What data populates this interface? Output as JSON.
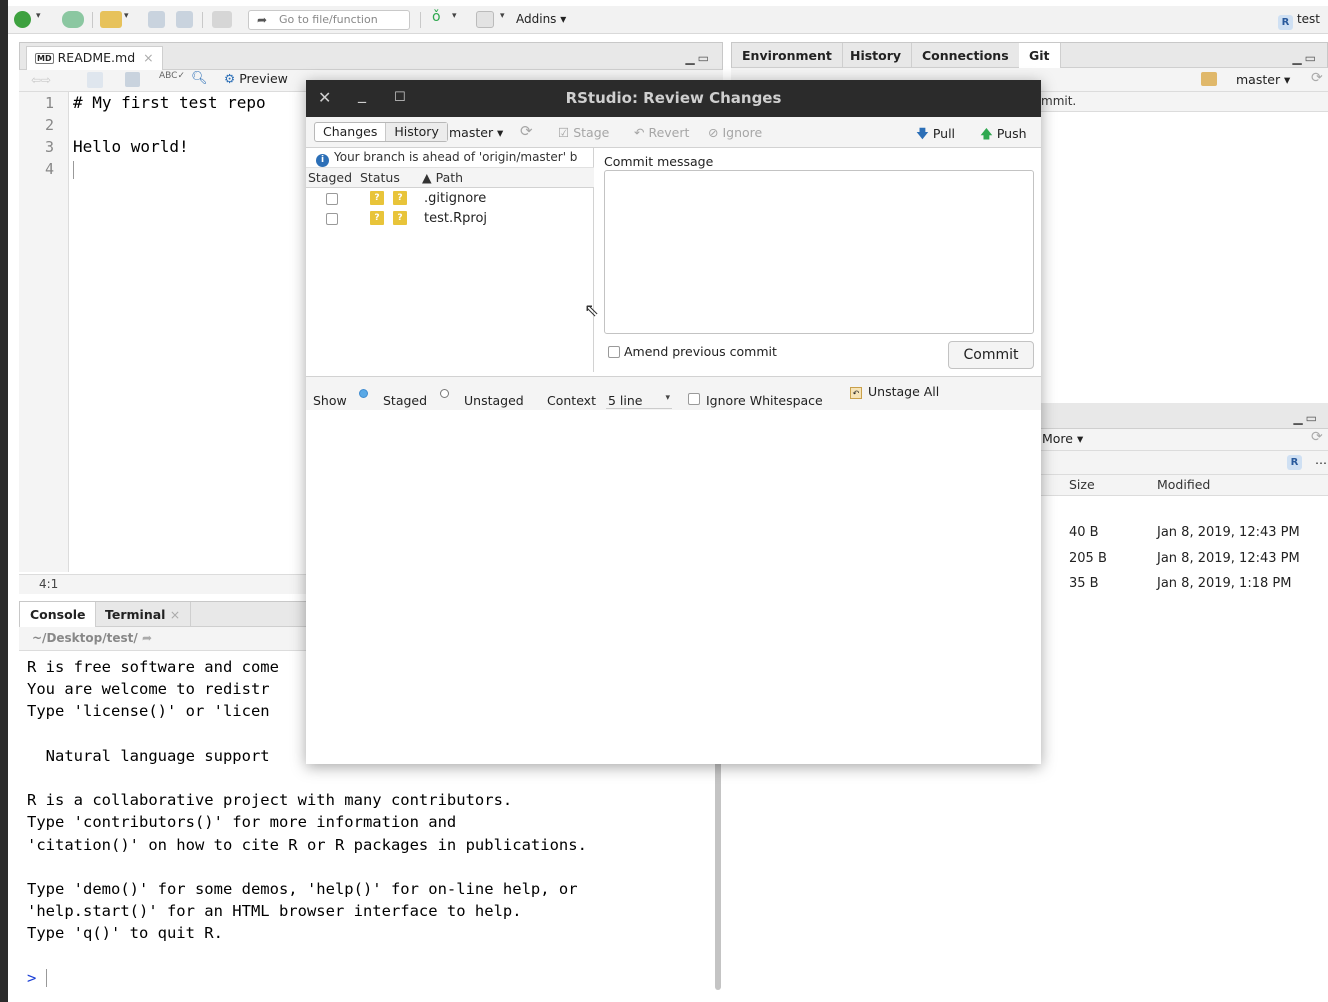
{
  "toolbar": {
    "goto_placeholder": "Go to file/function",
    "addins_label": "Addins ▾",
    "project_label": "test",
    "project_badge": "R"
  },
  "editor": {
    "tab_icon_label": "MD",
    "tab_title": "README.md",
    "tab_close": "×",
    "preview_label": "Preview",
    "line_numbers": [
      "1",
      "2",
      "3",
      "4"
    ],
    "lines": [
      "# My first test repo",
      "",
      "Hello world!",
      ""
    ],
    "cursor_position": "4:1"
  },
  "console": {
    "tabs": [
      "Console",
      "Terminal"
    ],
    "terminal_close": "×",
    "path": "~/Desktop/test/",
    "lines": [
      "R is free software and come",
      "You are welcome to redistr",
      "Type 'license()' or 'licen",
      "",
      "  Natural language support",
      "",
      "R is a collaborative project with many contributors.",
      "Type 'contributors()' for more information and",
      "'citation()' on how to cite R or R packages in publications.",
      "",
      "Type 'demo()' for some demos, 'help()' for on-line help, or",
      "'help.start()' for an HTML browser interface to help.",
      "Type 'q()' to quit R.",
      "",
      ""
    ],
    "prompt": ">"
  },
  "env_pane": {
    "tabs": [
      "Environment",
      "History",
      "Connections",
      "Git"
    ],
    "branch_label": "master ▾",
    "sub_text": "mmit."
  },
  "files_pane": {
    "more_label": "More ▾",
    "columns": [
      "Size",
      "Modified"
    ],
    "rows": [
      {
        "size": "40 B",
        "modified": "Jan 8, 2019, 12:43 PM"
      },
      {
        "size": "205 B",
        "modified": "Jan 8, 2019, 12:43 PM"
      },
      {
        "size": "35 B",
        "modified": "Jan 8, 2019, 1:18 PM"
      }
    ]
  },
  "dialog": {
    "title": "RStudio: Review Changes",
    "close": "✕",
    "minimize": "_",
    "maximize": "☐",
    "view_tabs": [
      "Changes",
      "History"
    ],
    "branch": "master ▾",
    "stage": "Stage",
    "revert": "Revert",
    "ignore": "Ignore",
    "pull": "Pull",
    "push": "Push",
    "info_icon": "i",
    "ahead_message": "Your branch is ahead of 'origin/master' b",
    "columns": {
      "staged": "Staged",
      "status": "Status",
      "path": "▲ Path"
    },
    "files": [
      {
        "status_a": "?",
        "status_b": "?",
        "path": ".gitignore"
      },
      {
        "status_a": "?",
        "status_b": "?",
        "path": "test.Rproj"
      }
    ],
    "commit_message_label": "Commit message",
    "amend_label": "Amend previous commit",
    "commit_button": "Commit",
    "show_label": "Show",
    "staged_label": "Staged",
    "unstaged_label": "Unstaged",
    "context_label": "Context",
    "context_value": "5 line",
    "ignore_whitespace_label": "Ignore Whitespace",
    "unstage_all_label": "Unstage All"
  },
  "colors": {
    "title_bar": "#2b2b2b",
    "accent_blue": "#2c6fb7",
    "status_yellow": "#e8c43a",
    "push_green": "#2fa84f",
    "prompt_blue": "#1a3fd6"
  }
}
